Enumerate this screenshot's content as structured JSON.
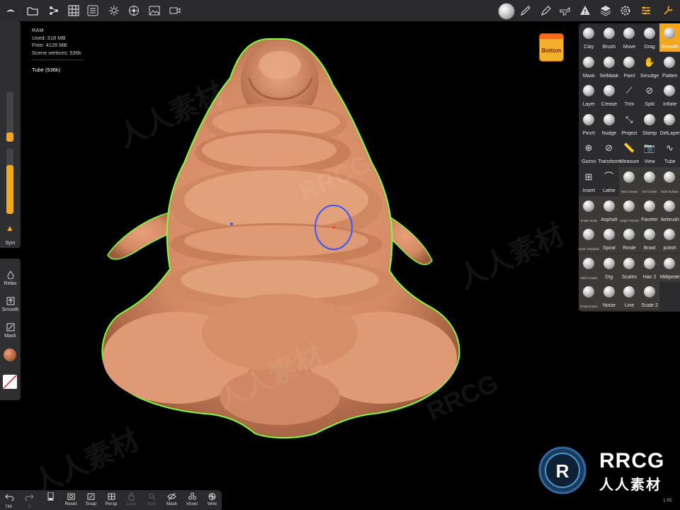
{
  "app": {
    "name": "Nomad Sculpt",
    "version": "1.65"
  },
  "stats": {
    "title": "RAM",
    "used": "Used: 318 MB",
    "free": "Free: 4126 MB",
    "scene_vertices": "Scene vertices: 536k",
    "separator": "-----------------------------",
    "selected_object": "Tube (536k)"
  },
  "colors": {
    "accent": "#f2a81c",
    "panel": "#2c2c2e",
    "skin": "#d98f6a",
    "outline": "#7cff3a",
    "cursor": "#3a55ff"
  },
  "top_icons_left": [
    "logo-icon",
    "folder-icon",
    "scene-icon",
    "grid-icon",
    "menu-icon",
    "sun-icon",
    "material-icon",
    "image-icon",
    "video-icon"
  ],
  "top_icons_right": [
    "matcap-icon",
    "brush-icon",
    "pen-icon",
    "gun-icon",
    "warning-icon",
    "layers-icon",
    "settings-icon",
    "tools-icon",
    "wrench-icon"
  ],
  "left": {
    "sym": "Sym",
    "radius_level": 0.18,
    "intensity_level": 0.75,
    "relax": "Relax",
    "smooth": "Smooth",
    "mask": "Mask"
  },
  "view_button": "Bottom",
  "tools": [
    {
      "label": "Clay",
      "kind": "ball"
    },
    {
      "label": "Brush",
      "kind": "ball"
    },
    {
      "label": "Move",
      "kind": "ball"
    },
    {
      "label": "Drag",
      "kind": "ball"
    },
    {
      "label": "Smooth",
      "kind": "ball",
      "selected": true
    },
    {
      "label": "Mask",
      "kind": "ball"
    },
    {
      "label": "SelMask",
      "kind": "ball"
    },
    {
      "label": "Paint",
      "kind": "ball"
    },
    {
      "label": "Smudge",
      "kind": "glyph",
      "glyph": "✋"
    },
    {
      "label": "Flatten",
      "kind": "ball"
    },
    {
      "label": "Layer",
      "kind": "ball"
    },
    {
      "label": "Crease",
      "kind": "ball"
    },
    {
      "label": "Trim",
      "kind": "glyph",
      "glyph": "⟋"
    },
    {
      "label": "Split",
      "kind": "glyph",
      "glyph": "⊘"
    },
    {
      "label": "Inflate",
      "kind": "ball"
    },
    {
      "label": "Pinch",
      "kind": "ball"
    },
    {
      "label": "Nudge",
      "kind": "ball"
    },
    {
      "label": "Project",
      "kind": "glyph",
      "glyph": "⤡"
    },
    {
      "label": "Stamp",
      "kind": "ball"
    },
    {
      "label": "DelLayer",
      "kind": "ball"
    },
    {
      "label": "Gizmo",
      "kind": "glyph",
      "glyph": "⊕"
    },
    {
      "label": "Transform",
      "kind": "glyph",
      "glyph": "⊘"
    },
    {
      "label": "Measure",
      "kind": "glyph",
      "glyph": "📏"
    },
    {
      "label": "View",
      "kind": "glyph",
      "glyph": "📷"
    },
    {
      "label": "Tube",
      "kind": "glyph",
      "glyph": "∿"
    },
    {
      "label": "Insert",
      "kind": "glyph",
      "glyph": "⊞"
    },
    {
      "label": "Lathe",
      "kind": "glyph",
      "glyph": "⌒"
    },
    {
      "label": "New Crease",
      "kind": "ball",
      "small": true,
      "alt": true
    },
    {
      "label": "Fat Crease",
      "kind": "ball",
      "small": true,
      "alt": true
    },
    {
      "label": "Hard Surface",
      "kind": "ball",
      "small": true,
      "alt": true
    },
    {
      "label": "Snake Scale",
      "kind": "ball",
      "small": true,
      "alt": true
    },
    {
      "label": "Asphalt",
      "kind": "ball",
      "alt": true
    },
    {
      "label": "Larger Facetor",
      "kind": "ball",
      "small": true,
      "alt": true
    },
    {
      "label": "Faceter",
      "kind": "ball",
      "alt": true
    },
    {
      "label": "Airbrush",
      "kind": "ball",
      "alt": true
    },
    {
      "label": "Scale Transition",
      "kind": "ball",
      "small": true,
      "alt": true
    },
    {
      "label": "Spiral",
      "kind": "ball",
      "alt": true
    },
    {
      "label": "Rinde",
      "kind": "ball",
      "alt": true
    },
    {
      "label": "Braid",
      "kind": "ball",
      "alt": true
    },
    {
      "label": "polish",
      "kind": "ball",
      "alt": true
    },
    {
      "label": "Stitch Scales",
      "kind": "ball",
      "small": true,
      "alt": true
    },
    {
      "label": "Dig",
      "kind": "ball",
      "alt": true
    },
    {
      "label": "Scales",
      "kind": "ball",
      "alt": true
    },
    {
      "label": "Hair 2",
      "kind": "ball",
      "alt": true
    },
    {
      "label": "Millipede",
      "kind": "ball",
      "alt": true
    },
    {
      "label": "Gross Scales",
      "kind": "ball",
      "small": true,
      "alt": true
    },
    {
      "label": "Noise",
      "kind": "ball",
      "alt": true
    },
    {
      "label": "Line",
      "kind": "ball",
      "alt": true
    },
    {
      "label": "Scale 2",
      "kind": "ball",
      "alt": true
    }
  ],
  "bottom_bar": {
    "undo_count": "746",
    "redo_count": "0",
    "items": [
      {
        "label": "Reset",
        "icon": "reset-icon",
        "enabled": true
      },
      {
        "label": "Snap",
        "icon": "snap-icon",
        "enabled": true
      },
      {
        "label": "Persp",
        "icon": "persp-icon",
        "enabled": true
      },
      {
        "label": "Lock",
        "icon": "lock-icon",
        "enabled": false
      },
      {
        "label": "Solo",
        "icon": "solo-icon",
        "enabled": false
      },
      {
        "label": "Mask",
        "icon": "mask-eye-icon",
        "enabled": true
      },
      {
        "label": "Voxel",
        "icon": "voxel-icon",
        "enabled": true
      },
      {
        "label": "Wire",
        "icon": "wire-icon",
        "enabled": true
      }
    ]
  },
  "watermark": {
    "brand": "RRCG",
    "subtitle": "人人素材"
  }
}
